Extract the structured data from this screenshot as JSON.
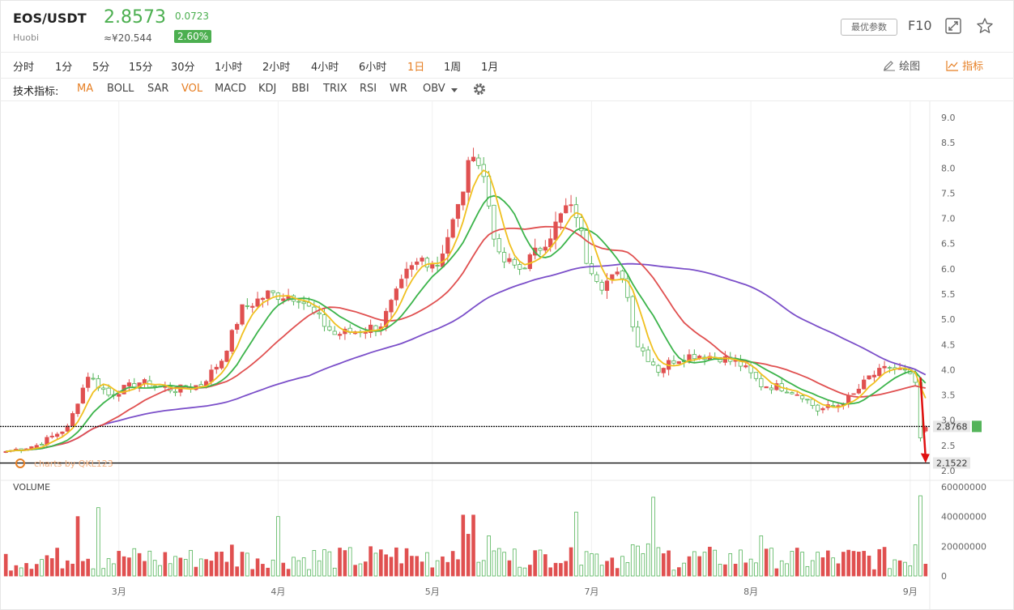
{
  "header": {
    "symbol": "EOS/USDT",
    "exchange": "Huobi",
    "price": "2.8573",
    "price_cny": "≈¥20.544",
    "change": "0.0723",
    "change_pct": "2.60%",
    "params_label": "最优参数",
    "f10_label": "F10"
  },
  "timeframes": [
    "分时",
    "1分",
    "5分",
    "15分",
    "30分",
    "1小时",
    "2小时",
    "4小时",
    "6小时",
    "1日",
    "1周",
    "1月"
  ],
  "active_timeframe": "1日",
  "tools": {
    "draw_label": "绘图",
    "indicator_label": "指标"
  },
  "indicators_label": "技术指标:",
  "indicators": [
    "MA",
    "BOLL",
    "SAR",
    "VOL",
    "MACD",
    "KDJ",
    "BBI",
    "TRIX",
    "RSI",
    "WR",
    "OBV"
  ],
  "active_indicators": [
    "MA",
    "VOL"
  ],
  "watermark": "charts by QKL123",
  "colors": {
    "up": "#e05050",
    "down": "#54b45a",
    "ma5": "#f0c020",
    "ma10": "#3cb44b",
    "ma20": "#e05050",
    "ma60": "#7b4fc9",
    "accent": "#e67e22"
  },
  "chart_data": {
    "type": "candlestick",
    "price_axis": {
      "ticks": [
        "9.0",
        "8.5",
        "8.0",
        "7.5",
        "7.0",
        "6.5",
        "6.0",
        "5.5",
        "5.0",
        "4.5",
        "4.0",
        "3.5",
        "3.0",
        "2.5",
        "2.0"
      ],
      "range": [
        2.0,
        9.0
      ]
    },
    "volume_axis": {
      "label": "VOLUME",
      "ticks": [
        "60000000",
        "40000000",
        "20000000",
        "0"
      ],
      "range": [
        0,
        60000000
      ]
    },
    "x_ticks": [
      {
        "label": "3月",
        "index": 22
      },
      {
        "label": "4月",
        "index": 53
      },
      {
        "label": "5月",
        "index": 83
      },
      {
        "label": "7月",
        "index": 114
      },
      {
        "label": "8月",
        "index": 145
      },
      {
        "label": "9月",
        "index": 176
      }
    ],
    "horizontal_lines": [
      {
        "value": 2.8768,
        "label": "2.8768",
        "style": "dashed",
        "tag": "green"
      },
      {
        "value": 2.1522,
        "label": "2.1522",
        "style": "solid",
        "tag": "gray"
      }
    ],
    "close_anchors": [
      [
        0,
        2.38
      ],
      [
        6,
        2.5
      ],
      [
        12,
        2.85
      ],
      [
        16,
        3.9
      ],
      [
        20,
        3.5
      ],
      [
        26,
        3.75
      ],
      [
        33,
        3.6
      ],
      [
        38,
        3.7
      ],
      [
        42,
        4.2
      ],
      [
        46,
        5.2
      ],
      [
        51,
        5.5
      ],
      [
        57,
        5.45
      ],
      [
        60,
        5.1
      ],
      [
        64,
        4.7
      ],
      [
        70,
        4.8
      ],
      [
        73,
        4.9
      ],
      [
        78,
        5.9
      ],
      [
        81,
        6.2
      ],
      [
        84,
        6.1
      ],
      [
        88,
        7.2
      ],
      [
        91,
        8.4
      ],
      [
        93,
        7.8
      ],
      [
        96,
        6.2
      ],
      [
        100,
        6.0
      ],
      [
        103,
        6.3
      ],
      [
        106,
        6.7
      ],
      [
        109,
        7.2
      ],
      [
        111,
        7.1
      ],
      [
        113,
        6.2
      ],
      [
        116,
        5.7
      ],
      [
        120,
        5.9
      ],
      [
        123,
        4.5
      ],
      [
        127,
        4.0
      ],
      [
        130,
        4.2
      ],
      [
        134,
        4.3
      ],
      [
        139,
        4.25
      ],
      [
        143,
        4.1
      ],
      [
        147,
        3.7
      ],
      [
        151,
        3.65
      ],
      [
        155,
        3.5
      ],
      [
        158,
        3.2
      ],
      [
        162,
        3.3
      ],
      [
        165,
        3.5
      ],
      [
        168,
        3.85
      ],
      [
        172,
        4.05
      ],
      [
        175,
        3.95
      ],
      [
        177,
        3.75
      ],
      [
        178,
        2.65
      ],
      [
        179,
        2.8573
      ]
    ],
    "volume_highlights": [
      {
        "index": 18,
        "value": 46000000
      },
      {
        "index": 14,
        "value": 40000000
      },
      {
        "index": 53,
        "value": 40000000
      },
      {
        "index": 89,
        "value": 41000000
      },
      {
        "index": 91,
        "value": 41000000
      },
      {
        "index": 111,
        "value": 43000000
      },
      {
        "index": 126,
        "value": 53000000
      },
      {
        "index": 147,
        "value": 27000000
      },
      {
        "index": 178,
        "value": 54000000
      },
      {
        "index": 177,
        "value": 21000000
      }
    ],
    "annotation": {
      "type": "arrow",
      "from": [
        178,
        3.85
      ],
      "to": [
        179,
        2.1522
      ],
      "color": "#e01010"
    }
  }
}
